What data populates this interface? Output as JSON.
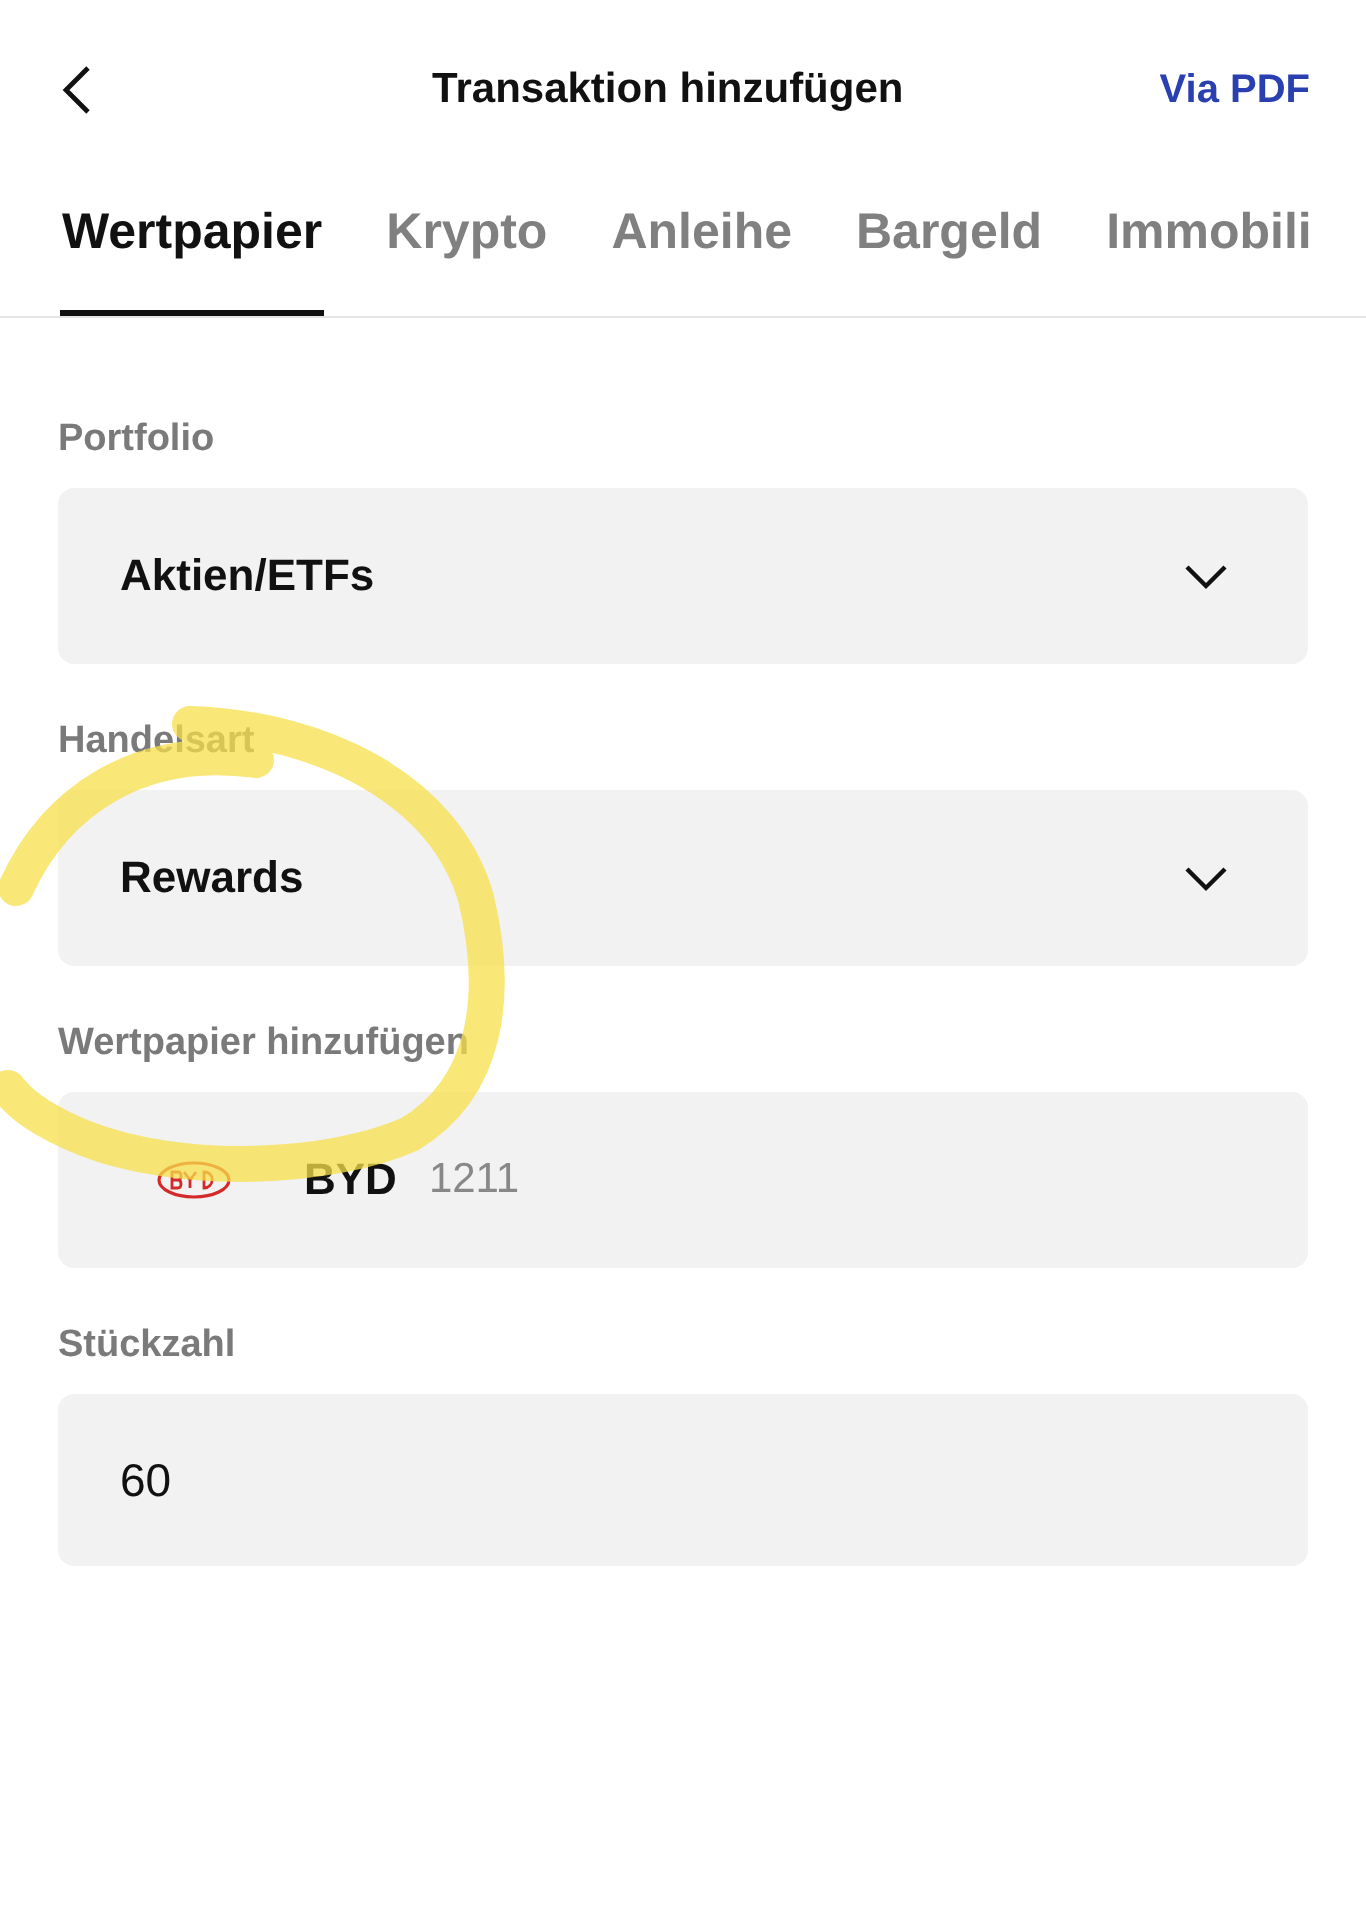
{
  "header": {
    "title": "Transaktion hinzufügen",
    "action": "Via PDF"
  },
  "tabs": [
    {
      "label": "Wertpapier",
      "selected": true
    },
    {
      "label": "Krypto",
      "selected": false
    },
    {
      "label": "Anleihe",
      "selected": false
    },
    {
      "label": "Bargeld",
      "selected": false
    },
    {
      "label": "Immobili",
      "selected": false
    }
  ],
  "fields": [
    {
      "kind": "select",
      "label": "Portfolio",
      "value": "Aktien/ETFs"
    },
    {
      "kind": "select",
      "label": "Handelsart",
      "value": "Rewards"
    },
    {
      "kind": "security",
      "label": "Wertpapier hinzufügen",
      "value": "BYD",
      "code": "1211"
    },
    {
      "kind": "number",
      "label": "Stückzahl",
      "value": "60"
    }
  ]
}
